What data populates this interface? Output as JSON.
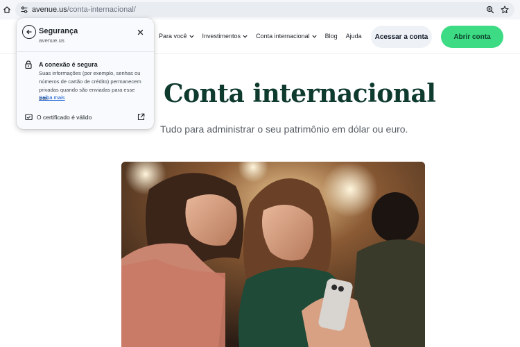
{
  "browser": {
    "url_host": "avenue.us",
    "url_path": "/conta-internacional/",
    "icons": {
      "home": "home-icon",
      "site_info": "tune-icon",
      "zoom": "zoom-icon",
      "bookmark": "star-icon"
    }
  },
  "security_popup": {
    "title": "Segurança",
    "domain": "avenue.us",
    "connection_title": "A conexão é segura",
    "connection_description": "Suas informações (por exemplo, senhas ou números de cartão de crédito) permanecem privadas quando são enviadas para esse site.",
    "learn_more": "Saiba mais",
    "certificate_label": "O certificado é válido"
  },
  "site_header": {
    "nav": [
      {
        "label": "Para você",
        "has_dropdown": true
      },
      {
        "label": "Investimentos",
        "has_dropdown": true
      },
      {
        "label": "Conta internacional",
        "has_dropdown": true
      },
      {
        "label": "Blog",
        "has_dropdown": false
      },
      {
        "label": "Ajuda",
        "has_dropdown": false
      }
    ],
    "login_button": "Acessar a conta",
    "open_account_button": "Abrir conta"
  },
  "hero": {
    "title": "Conta internacional",
    "subtitle": "Tudo para administrar o seu patrimônio em dólar ou euro."
  },
  "colors": {
    "brand_green": "#3ddc84",
    "title_green": "#0f3a2e",
    "link_blue": "#0b57d0"
  }
}
